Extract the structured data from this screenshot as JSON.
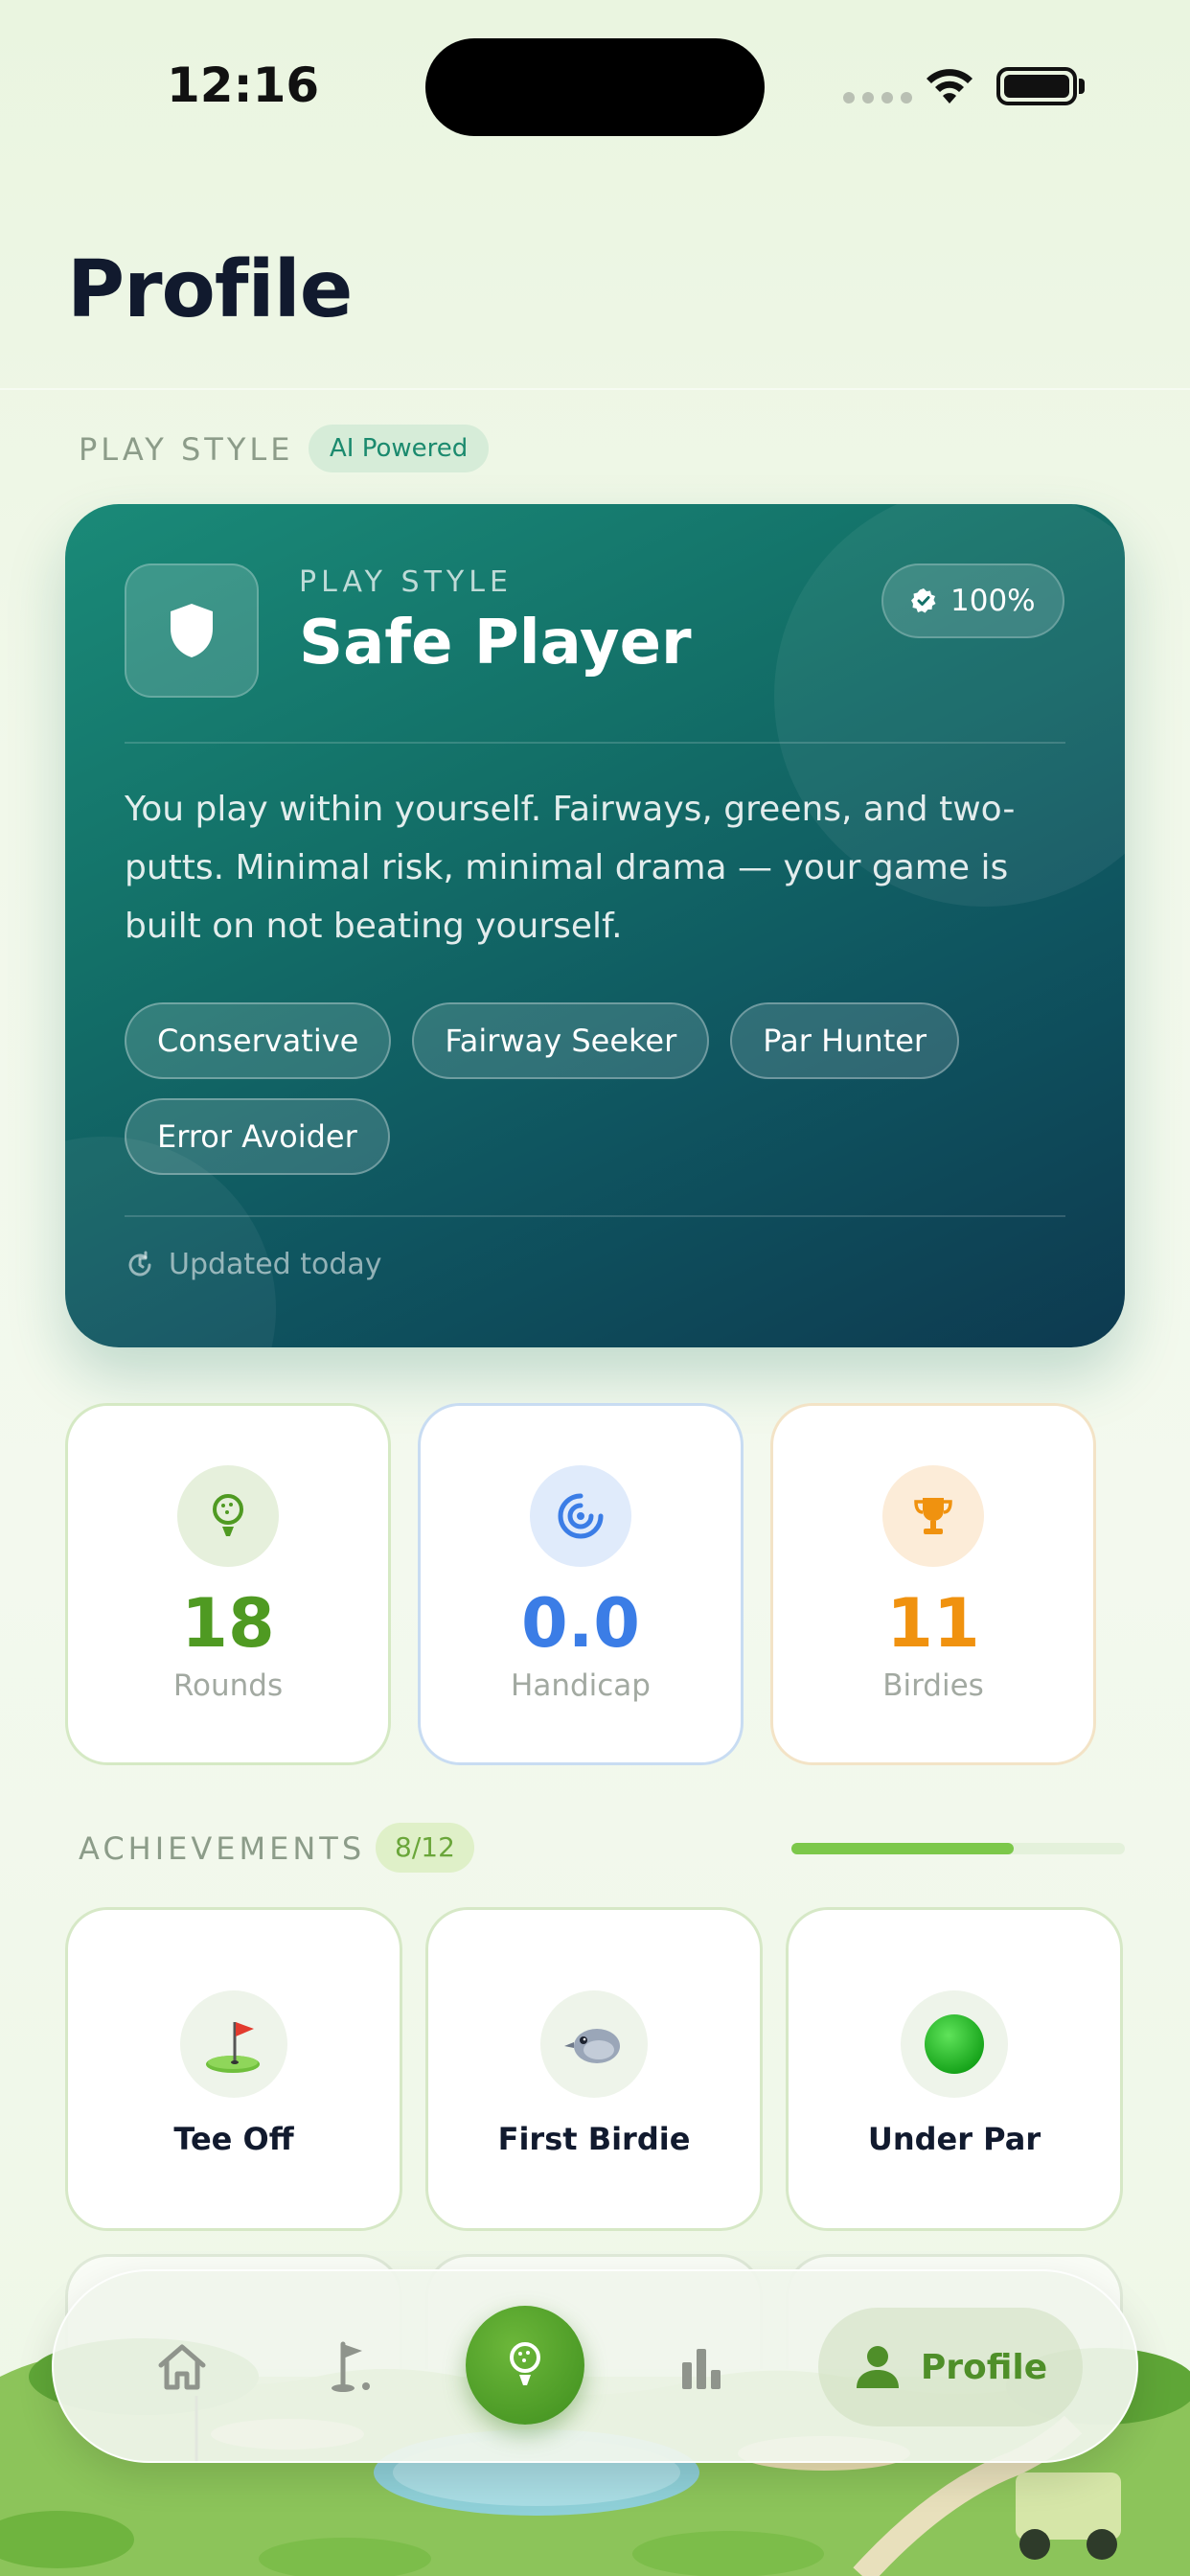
{
  "status_bar": {
    "time": "12:16"
  },
  "page": {
    "title": "Profile"
  },
  "play_style_section": {
    "label": "PLAY STYLE",
    "badge": "AI Powered",
    "card": {
      "eyebrow": "PLAY STYLE",
      "name": "Safe Player",
      "confidence": "100%",
      "description": "You play within yourself. Fairways, greens, and two-putts. Minimal risk, minimal drama — your game is built on not beating yourself.",
      "tags": [
        "Conservative",
        "Fairway Seeker",
        "Par Hunter",
        "Error Avoider"
      ],
      "updated": "Updated today",
      "icon": "shield-icon"
    }
  },
  "stats": [
    {
      "value": "18",
      "label": "Rounds",
      "icon": "golf-ball-icon",
      "color": "#4f9a22"
    },
    {
      "value": "0.0",
      "label": "Handicap",
      "icon": "target-icon",
      "color": "#3b7de6"
    },
    {
      "value": "11",
      "label": "Birdies",
      "icon": "trophy-icon",
      "color": "#f0920f"
    }
  ],
  "achievements": {
    "label": "ACHIEVEMENTS",
    "count": "8/12",
    "progress": 0.667,
    "items": [
      {
        "label": "Tee Off",
        "icon": "flag-on-green-icon"
      },
      {
        "label": "First Birdie",
        "icon": "bird-icon"
      },
      {
        "label": "Under Par",
        "icon": "green-circle-icon"
      }
    ]
  },
  "tab_bar": {
    "items": [
      {
        "name": "home",
        "icon": "home-icon"
      },
      {
        "name": "course",
        "icon": "golf-flag-icon"
      },
      {
        "name": "play",
        "icon": "golf-ball-icon"
      },
      {
        "name": "stats",
        "icon": "bar-chart-icon"
      },
      {
        "name": "profile",
        "icon": "person-icon",
        "label": "Profile",
        "active": true
      }
    ]
  },
  "colors": {
    "accent_green": "#4f9a22",
    "card_teal": "#137068",
    "handicap_blue": "#3b7de6",
    "birdies_orange": "#f0920f"
  }
}
